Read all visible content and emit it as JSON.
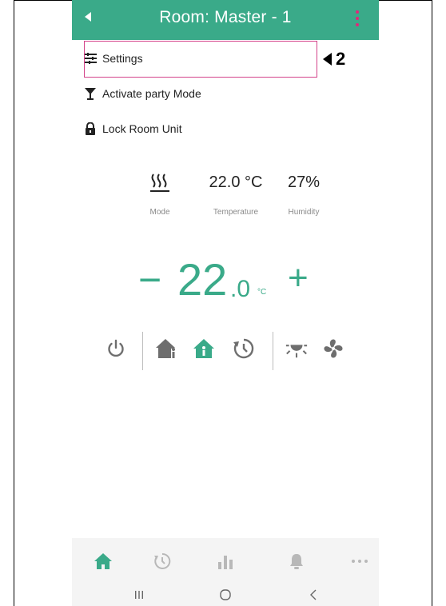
{
  "header": {
    "title": "Room: Master - 1"
  },
  "menu": {
    "items": [
      {
        "label": "Settings",
        "icon": "settings-sliders-icon"
      },
      {
        "label": "Activate party Mode",
        "icon": "cocktail-glass-icon"
      },
      {
        "label": "Lock Room Unit",
        "icon": "lock-icon"
      }
    ]
  },
  "callout": {
    "number": "2"
  },
  "status": {
    "mode": {
      "label": "Mode",
      "icon": "heating-waves-icon"
    },
    "temperature": {
      "label": "Temperature",
      "value": "22.0 °C"
    },
    "humidity": {
      "label": "Humidity",
      "value": "27%"
    }
  },
  "setpoint": {
    "minus": "−",
    "integer": "22",
    "decimal": ".0",
    "unit": "°C",
    "plus": "+"
  },
  "controls": {
    "icons": [
      "power-icon",
      "home-away-icon",
      "home-present-icon",
      "timer-icon",
      "cooling-icon",
      "fan-icon"
    ],
    "active": "home-present-icon"
  },
  "bottom_nav": {
    "items": [
      "home-icon",
      "schedule-icon",
      "statistics-icon",
      "notifications-icon",
      "more-icon"
    ],
    "active": "home-icon"
  },
  "system_nav": {
    "items": [
      "recent-apps-icon",
      "home-circle-icon",
      "back-chevron-icon"
    ]
  },
  "colors": {
    "accent": "#3aaa89",
    "highlight": "#d4438a",
    "menu_dots": "#e0287a",
    "inactive_icon": "#6e6e6e",
    "nav_inactive": "#b8b8b8"
  }
}
